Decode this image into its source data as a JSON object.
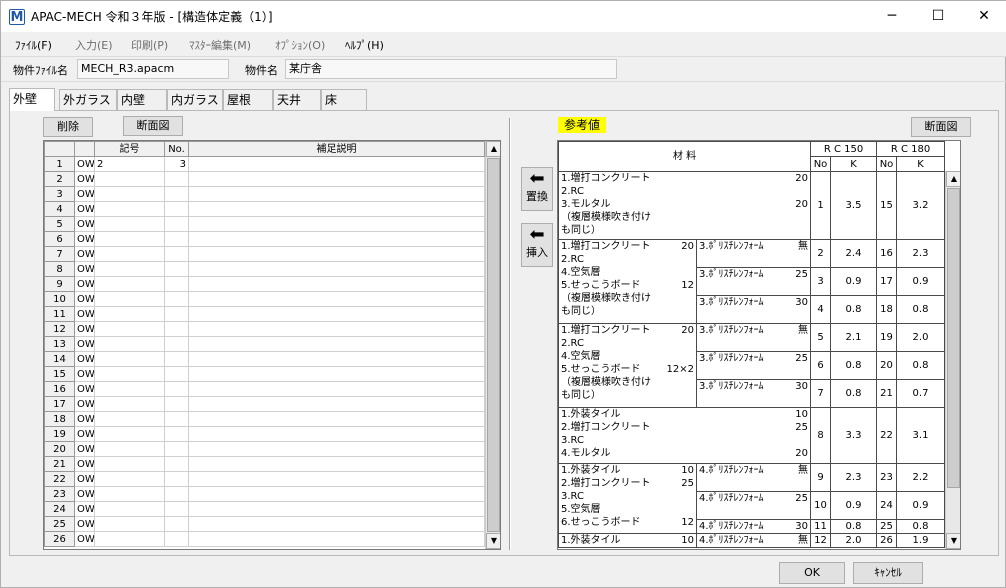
{
  "window": {
    "icon": "M",
    "title": "APAC-MECH 令和３年版 - [構造体定義（1）]",
    "minimize": "─",
    "maximize": "☐",
    "close": "✕"
  },
  "menu": [
    "ﾌｧｲﾙ(F)",
    "入力(E)",
    "印刷(P)",
    "ﾏｽﾀｰ編集(M)",
    "ｵﾌﾟｼｮﾝ(O)",
    "ﾍﾙﾌﾟ(H)"
  ],
  "info": {
    "file_label": "物件ﾌｧｲﾙ名",
    "file_value": "MECH_R3.apacm",
    "name_label": "物件名",
    "name_value": "某庁舎"
  },
  "tabs": [
    "外壁",
    "外ガラス",
    "内壁",
    "内ガラス",
    "屋根",
    "天井",
    "床"
  ],
  "left": {
    "delete_btn": "削除",
    "section_btn": "断面図",
    "headers": [
      "記号",
      "No.",
      "補足説明"
    ],
    "rows": [
      {
        "n": "1",
        "code": "OW",
        "kigo": "2",
        "no": "3"
      },
      {
        "n": "2",
        "code": "OW"
      },
      {
        "n": "3",
        "code": "OW"
      },
      {
        "n": "4",
        "code": "OW"
      },
      {
        "n": "5",
        "code": "OW"
      },
      {
        "n": "6",
        "code": "OW"
      },
      {
        "n": "7",
        "code": "OW"
      },
      {
        "n": "8",
        "code": "OW"
      },
      {
        "n": "9",
        "code": "OW"
      },
      {
        "n": "10",
        "code": "OW"
      },
      {
        "n": "11",
        "code": "OW"
      },
      {
        "n": "12",
        "code": "OW"
      },
      {
        "n": "13",
        "code": "OW"
      },
      {
        "n": "14",
        "code": "OW"
      },
      {
        "n": "15",
        "code": "OW"
      },
      {
        "n": "16",
        "code": "OW"
      },
      {
        "n": "17",
        "code": "OW"
      },
      {
        "n": "18",
        "code": "OW"
      },
      {
        "n": "19",
        "code": "OW"
      },
      {
        "n": "20",
        "code": "OW"
      },
      {
        "n": "21",
        "code": "OW"
      },
      {
        "n": "22",
        "code": "OW"
      },
      {
        "n": "23",
        "code": "OW"
      },
      {
        "n": "24",
        "code": "OW"
      },
      {
        "n": "25",
        "code": "OW"
      },
      {
        "n": "26",
        "code": "OW"
      }
    ]
  },
  "side": {
    "replace": "置換",
    "insert": "挿入"
  },
  "ref": {
    "label": "参考値",
    "section_btn": "断面図",
    "material_hdr": "材 料",
    "rc150": "R C 150",
    "rc180": "R C 180",
    "no": "No",
    "k": "K",
    "groups": [
      {
        "lines": [
          [
            "1.増打コンクリート",
            "20"
          ],
          [
            "2.RC",
            ""
          ],
          [
            "3.モルタル",
            "20"
          ],
          [
            "（複層模様吹き付け",
            ""
          ],
          [
            "も同じ）",
            ""
          ]
        ],
        "rows": [
          {
            "ins": "",
            "ins_v": "",
            "no1": "1",
            "k1": "3.5",
            "no2": "15",
            "k2": "3.2",
            "h": 68
          }
        ]
      },
      {
        "lines": [
          [
            "1.増打コンクリート",
            "20"
          ],
          [
            "2.RC",
            ""
          ],
          [
            "4.空気層",
            ""
          ],
          [
            "5.せっこうボード",
            "12"
          ],
          [
            "（複層模様吹き付け",
            ""
          ],
          [
            "も同じ）",
            ""
          ]
        ],
        "rows": [
          {
            "ins": "3.ﾎﾟﾘｽﾁﾚﾝﾌｫｰﾑ",
            "ins_v": "無",
            "no1": "2",
            "k1": "2.4",
            "no2": "16",
            "k2": "2.3",
            "h": 28
          },
          {
            "ins": "3.ﾎﾟﾘｽﾁﾚﾝﾌｫｰﾑ",
            "ins_v": "25",
            "no1": "3",
            "k1": "0.9",
            "no2": "17",
            "k2": "0.9",
            "h": 28
          },
          {
            "ins": "3.ﾎﾟﾘｽﾁﾚﾝﾌｫｰﾑ",
            "ins_v": "30",
            "no1": "4",
            "k1": "0.8",
            "no2": "18",
            "k2": "0.8",
            "h": 28
          }
        ]
      },
      {
        "lines": [
          [
            "1.増打コンクリート",
            "20"
          ],
          [
            "2.RC",
            ""
          ],
          [
            "4.空気層",
            ""
          ],
          [
            "5.せっこうボード",
            "12×2"
          ],
          [
            "（複層模様吹き付け",
            ""
          ],
          [
            "も同じ）",
            ""
          ]
        ],
        "rows": [
          {
            "ins": "3.ﾎﾟﾘｽﾁﾚﾝﾌｫｰﾑ",
            "ins_v": "無",
            "no1": "5",
            "k1": "2.1",
            "no2": "19",
            "k2": "2.0",
            "h": 28
          },
          {
            "ins": "3.ﾎﾟﾘｽﾁﾚﾝﾌｫｰﾑ",
            "ins_v": "25",
            "no1": "6",
            "k1": "0.8",
            "no2": "20",
            "k2": "0.8",
            "h": 28
          },
          {
            "ins": "3.ﾎﾟﾘｽﾁﾚﾝﾌｫｰﾑ",
            "ins_v": "30",
            "no1": "7",
            "k1": "0.8",
            "no2": "21",
            "k2": "0.7",
            "h": 28
          }
        ]
      },
      {
        "lines": [
          [
            "1.外装タイル",
            "10"
          ],
          [
            "2.増打コンクリート",
            "25"
          ],
          [
            "3.RC",
            ""
          ],
          [
            "4.モルタル",
            "20"
          ]
        ],
        "rows": [
          {
            "ins": "",
            "ins_v": "",
            "no1": "8",
            "k1": "3.3",
            "no2": "22",
            "k2": "3.1",
            "h": 56
          }
        ]
      },
      {
        "lines": [
          [
            "1.外装タイル",
            "10"
          ],
          [
            "2.増打コンクリート",
            "25"
          ],
          [
            "3.RC",
            ""
          ],
          [
            "5.空気層",
            ""
          ],
          [
            "6.せっこうボード",
            "12"
          ]
        ],
        "rows": [
          {
            "ins": "4.ﾎﾟﾘｽﾁﾚﾝﾌｫｰﾑ",
            "ins_v": "無",
            "no1": "9",
            "k1": "2.3",
            "no2": "23",
            "k2": "2.2",
            "h": 28
          },
          {
            "ins": "4.ﾎﾟﾘｽﾁﾚﾝﾌｫｰﾑ",
            "ins_v": "25",
            "no1": "10",
            "k1": "0.9",
            "no2": "24",
            "k2": "0.9",
            "h": 28
          },
          {
            "ins": "4.ﾎﾟﾘｽﾁﾚﾝﾌｫｰﾑ",
            "ins_v": "30",
            "no1": "11",
            "k1": "0.8",
            "no2": "25",
            "k2": "0.8",
            "h": 14
          }
        ]
      },
      {
        "lines": [
          [
            "1.外装タイル",
            "10"
          ]
        ],
        "rows": [
          {
            "ins": "4.ﾎﾟﾘｽﾁﾚﾝﾌｫｰﾑ",
            "ins_v": "無",
            "no1": "12",
            "k1": "2.0",
            "no2": "26",
            "k2": "1.9",
            "h": 14
          }
        ]
      }
    ]
  },
  "footer": {
    "ok": "OK",
    "cancel": "ｷｬﾝｾﾙ"
  }
}
